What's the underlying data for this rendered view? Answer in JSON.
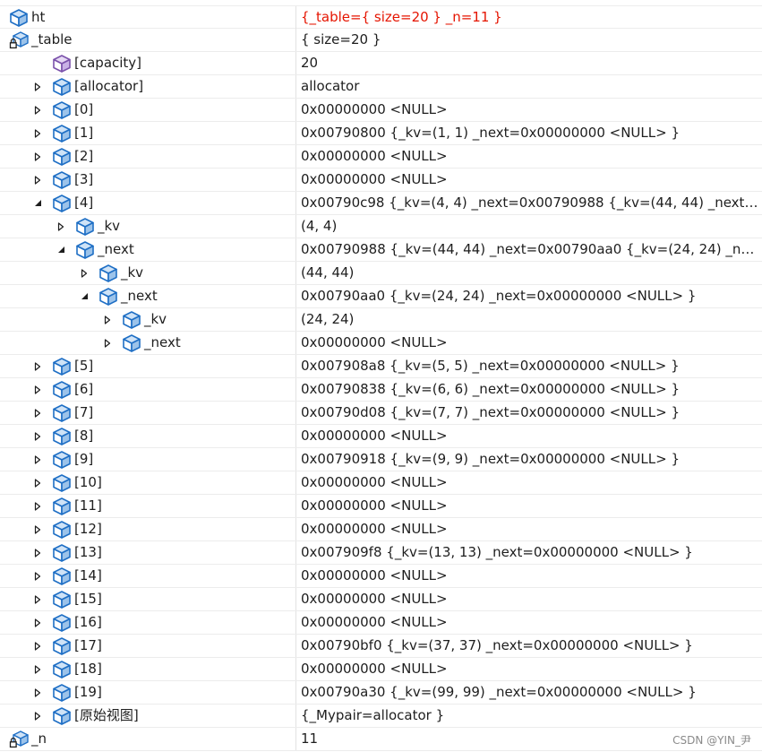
{
  "rows": [
    {
      "name": "ht",
      "value": "{_table={ size=20 } _n=11 }",
      "depth": 0,
      "expander": "none",
      "icon": "field-icon",
      "changed": true
    },
    {
      "name": "_table",
      "value": "{ size=20 }",
      "depth": 0,
      "expander": "expanded",
      "icon": "private-field-icon",
      "changed": false
    },
    {
      "name": "[capacity]",
      "value": "20",
      "depth": 1,
      "expander": "none",
      "icon": "raw-view-cube-icon",
      "changed": false
    },
    {
      "name": "[allocator]",
      "value": "allocator",
      "depth": 1,
      "expander": "collapsed",
      "icon": "field-icon",
      "changed": false
    },
    {
      "name": "[0]",
      "value": "0x00000000 <NULL>",
      "depth": 1,
      "expander": "collapsed",
      "icon": "field-icon",
      "changed": false
    },
    {
      "name": "[1]",
      "value": "0x00790800 {_kv=(1, 1) _next=0x00000000 <NULL> }",
      "depth": 1,
      "expander": "collapsed",
      "icon": "field-icon",
      "changed": false
    },
    {
      "name": "[2]",
      "value": "0x00000000 <NULL>",
      "depth": 1,
      "expander": "collapsed",
      "icon": "field-icon",
      "changed": false
    },
    {
      "name": "[3]",
      "value": "0x00000000 <NULL>",
      "depth": 1,
      "expander": "collapsed",
      "icon": "field-icon",
      "changed": false
    },
    {
      "name": "[4]",
      "value": "0x00790c98 {_kv=(4, 4) _next=0x00790988 {_kv=(44, 44) _next=0...",
      "depth": 1,
      "expander": "expanded",
      "icon": "field-icon",
      "changed": false
    },
    {
      "name": "_kv",
      "value": "(4, 4)",
      "depth": 2,
      "expander": "collapsed",
      "icon": "field-icon",
      "changed": false
    },
    {
      "name": "_next",
      "value": "0x00790988 {_kv=(44, 44) _next=0x00790aa0 {_kv=(24, 24) _next...",
      "depth": 2,
      "expander": "expanded",
      "icon": "field-icon",
      "changed": false
    },
    {
      "name": "_kv",
      "value": "(44, 44)",
      "depth": 3,
      "expander": "collapsed",
      "icon": "field-icon",
      "changed": false
    },
    {
      "name": "_next",
      "value": "0x00790aa0 {_kv=(24, 24) _next=0x00000000 <NULL> }",
      "depth": 3,
      "expander": "expanded",
      "icon": "field-icon",
      "changed": false
    },
    {
      "name": "_kv",
      "value": "(24, 24)",
      "depth": 4,
      "expander": "collapsed",
      "icon": "field-icon",
      "changed": false
    },
    {
      "name": "_next",
      "value": "0x00000000 <NULL>",
      "depth": 4,
      "expander": "collapsed",
      "icon": "field-icon",
      "changed": false
    },
    {
      "name": "[5]",
      "value": "0x007908a8 {_kv=(5, 5) _next=0x00000000 <NULL> }",
      "depth": 1,
      "expander": "collapsed",
      "icon": "field-icon",
      "changed": false
    },
    {
      "name": "[6]",
      "value": "0x00790838 {_kv=(6, 6) _next=0x00000000 <NULL> }",
      "depth": 1,
      "expander": "collapsed",
      "icon": "field-icon",
      "changed": false
    },
    {
      "name": "[7]",
      "value": "0x00790d08 {_kv=(7, 7) _next=0x00000000 <NULL> }",
      "depth": 1,
      "expander": "collapsed",
      "icon": "field-icon",
      "changed": false
    },
    {
      "name": "[8]",
      "value": "0x00000000 <NULL>",
      "depth": 1,
      "expander": "collapsed",
      "icon": "field-icon",
      "changed": false
    },
    {
      "name": "[9]",
      "value": "0x00790918 {_kv=(9, 9) _next=0x00000000 <NULL> }",
      "depth": 1,
      "expander": "collapsed",
      "icon": "field-icon",
      "changed": false
    },
    {
      "name": "[10]",
      "value": "0x00000000 <NULL>",
      "depth": 1,
      "expander": "collapsed",
      "icon": "field-icon",
      "changed": false
    },
    {
      "name": "[11]",
      "value": "0x00000000 <NULL>",
      "depth": 1,
      "expander": "collapsed",
      "icon": "field-icon",
      "changed": false
    },
    {
      "name": "[12]",
      "value": "0x00000000 <NULL>",
      "depth": 1,
      "expander": "collapsed",
      "icon": "field-icon",
      "changed": false
    },
    {
      "name": "[13]",
      "value": "0x007909f8 {_kv=(13, 13) _next=0x00000000 <NULL> }",
      "depth": 1,
      "expander": "collapsed",
      "icon": "field-icon",
      "changed": false
    },
    {
      "name": "[14]",
      "value": "0x00000000 <NULL>",
      "depth": 1,
      "expander": "collapsed",
      "icon": "field-icon",
      "changed": false
    },
    {
      "name": "[15]",
      "value": "0x00000000 <NULL>",
      "depth": 1,
      "expander": "collapsed",
      "icon": "field-icon",
      "changed": false
    },
    {
      "name": "[16]",
      "value": "0x00000000 <NULL>",
      "depth": 1,
      "expander": "collapsed",
      "icon": "field-icon",
      "changed": false
    },
    {
      "name": "[17]",
      "value": "0x00790bf0 {_kv=(37, 37) _next=0x00000000 <NULL> }",
      "depth": 1,
      "expander": "collapsed",
      "icon": "field-icon",
      "changed": false
    },
    {
      "name": "[18]",
      "value": "0x00000000 <NULL>",
      "depth": 1,
      "expander": "collapsed",
      "icon": "field-icon",
      "changed": false
    },
    {
      "name": "[19]",
      "value": "0x00790a30 {_kv=(99, 99) _next=0x00000000 <NULL> }",
      "depth": 1,
      "expander": "collapsed",
      "icon": "field-icon",
      "changed": false
    },
    {
      "name": "[原始视图]",
      "value": "{_Mypair=allocator }",
      "depth": 1,
      "expander": "collapsed",
      "icon": "field-icon",
      "changed": false
    },
    {
      "name": "_n",
      "value": "11",
      "depth": 0,
      "expander": "none",
      "icon": "private-field-icon",
      "changed": false
    }
  ],
  "watermark": "CSDN @YIN_尹",
  "colors": {
    "changed_value": "#e51400",
    "icon_blue": "#1f6fc5",
    "icon_purple": "#7b52ab",
    "grid_line": "#ececec"
  }
}
